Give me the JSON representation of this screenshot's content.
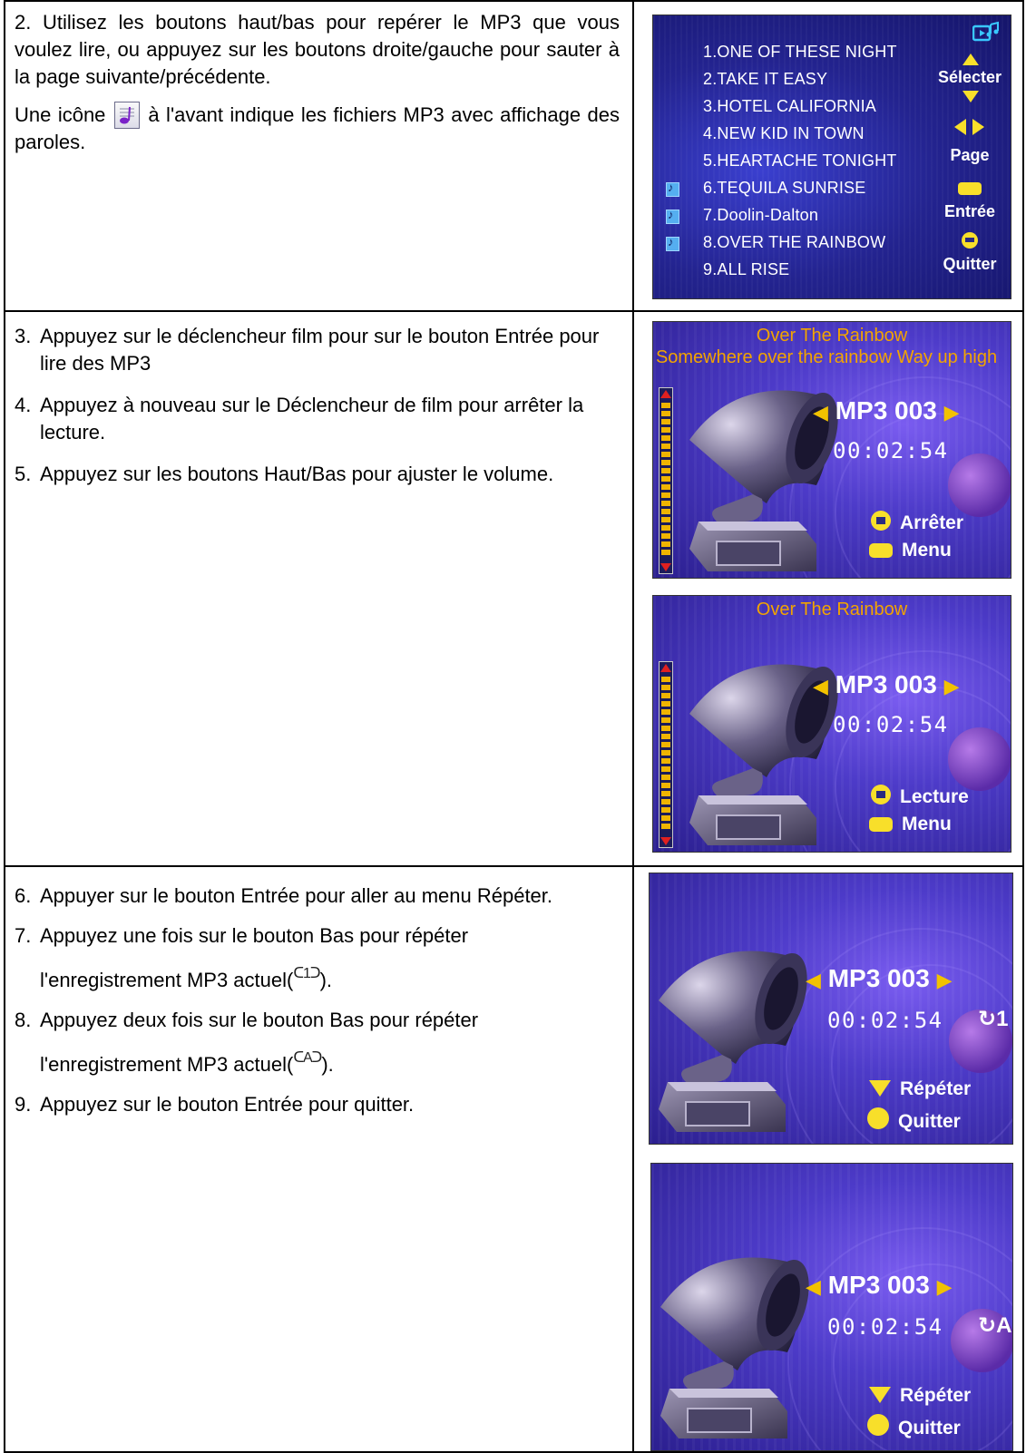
{
  "row1": {
    "step2_text": "2. Utilisez les boutons haut/bas pour repérer le MP3 que vous voulez lire, ou appuyez sur les boutons droite/gauche pour sauter à la page suivante/précédente.",
    "icon_note_before": "Une icône",
    "icon_note_after": "à l'avant indique les fichiers MP3 avec affichage des paroles.",
    "screen": {
      "tracks": [
        "1.ONE OF THESE NIGHT",
        "2.TAKE IT EASY",
        "3.HOTEL CALIFORNIA",
        "4.NEW KID IN TOWN",
        "5.HEARTACHE TONIGHT",
        "6.TEQUILA SUNRISE",
        "7.Doolin-Dalton",
        "8.OVER THE RAINBOW",
        "9.ALL RISE"
      ],
      "side_labels": {
        "select": "Sélecter",
        "page": "Page",
        "enter": "Entrée",
        "quit": "Quitter"
      }
    }
  },
  "row2": {
    "steps": [
      {
        "num": "3.",
        "text": "Appuyez sur le déclencheur film pour sur le bouton Entrée pour lire des MP3"
      },
      {
        "num": "4.",
        "text": "Appuyez à nouveau sur le Déclencheur de film pour arrêter la lecture."
      },
      {
        "num": "5.",
        "text": "Appuyez sur les boutons Haut/Bas pour ajuster le volume."
      }
    ],
    "screen_playing": {
      "song_title": "Over The Rainbow",
      "lyric": "Somewhere over the rainbow Way up high",
      "track_label": "MP3 003",
      "time": "00:02:54",
      "action_label": "Arrêter",
      "menu_label": "Menu"
    },
    "screen_stopped": {
      "song_title": "Over The Rainbow",
      "track_label": "MP3 003",
      "time": "00:02:54",
      "action_label": "Lecture",
      "menu_label": "Menu"
    }
  },
  "row3": {
    "steps": [
      {
        "num": "6.",
        "text": "Appuyer sur le bouton Entrée pour aller au menu Répéter."
      },
      {
        "num": "7.",
        "line1": "Appuyez une fois sur le bouton Bas pour répéter",
        "line2_before": "l'enregistrement MP3 actuel(",
        "glyph": "ᑕ1ᑐ",
        "line2_after": ")."
      },
      {
        "num": "8.",
        "line1": "Appuyez deux fois sur le bouton Bas pour répéter",
        "line2_before": "l'enregistrement MP3 actuel(",
        "glyph": "ᑕAᑐ",
        "line2_after": ")."
      },
      {
        "num": "9.",
        "text": "Appuyez sur le bouton Entrée pour quitter."
      }
    ],
    "screen_repeat_one": {
      "track_label": "MP3 003",
      "time": "00:02:54",
      "repeat_glyph": "↻1",
      "repeat_label": "Répéter",
      "quit_label": "Quitter"
    },
    "screen_repeat_all": {
      "track_label": "MP3 003",
      "time": "00:02:54",
      "repeat_glyph": "↻A",
      "repeat_label": "Répéter",
      "quit_label": "Quitter"
    }
  }
}
